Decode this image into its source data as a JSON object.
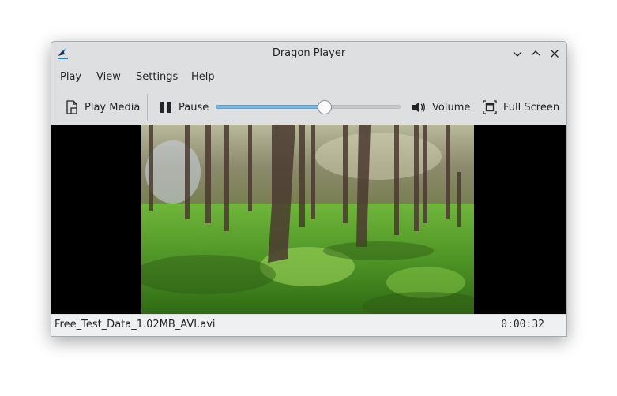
{
  "window": {
    "title": "Dragon Player",
    "app_icon": "dragon-player-icon",
    "controls": [
      "minimize-icon",
      "maximize-icon",
      "close-icon"
    ]
  },
  "menubar": {
    "items": [
      {
        "label": "Play"
      },
      {
        "label": "View"
      },
      {
        "label": "Settings"
      },
      {
        "label": "Help"
      }
    ]
  },
  "toolbar": {
    "play_media": {
      "label": "Play Media",
      "icon": "play-media-file-icon"
    },
    "pause": {
      "label": "Pause",
      "icon": "pause-icon"
    },
    "seek": {
      "position_fraction": 0.59
    },
    "volume": {
      "label": "Volume",
      "icon": "speaker-icon"
    },
    "fullscreen": {
      "label": "Full Screen",
      "icon": "fullscreen-icon"
    }
  },
  "video": {
    "description": "Forest scene with trees and green undergrowth in sunlight"
  },
  "statusbar": {
    "filename": "Free_Test_Data_1.02MB_AVI.avi",
    "time": "0:00:32"
  },
  "colors": {
    "accent": "#3daee9",
    "window_bg": "#dedfe0",
    "statusbar_bg": "#eff0f1"
  }
}
